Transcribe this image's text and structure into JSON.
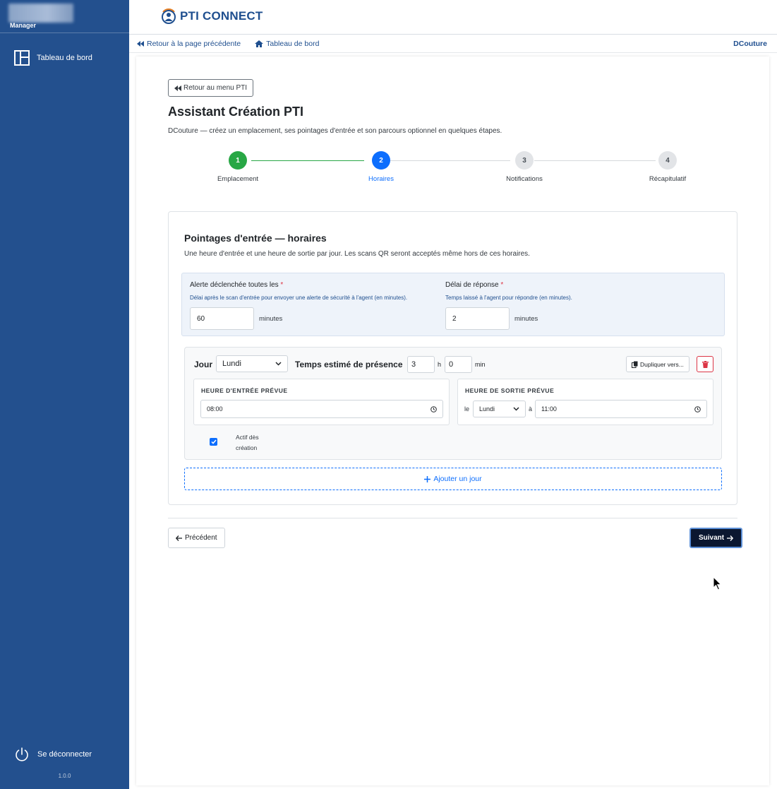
{
  "sidebar": {
    "role": "Manager",
    "nav": [
      {
        "label": "Tableau de bord",
        "icon": "dashboard-layout-icon"
      }
    ],
    "logout_label": "Se déconnecter",
    "version": "1.0.0"
  },
  "header": {
    "brand": "PTI CONNECT",
    "breadcrumbs": {
      "back_label": "Retour à la page précédente",
      "dashboard_label": "Tableau de bord"
    },
    "user": "DCouture"
  },
  "page": {
    "back_menu_label": "Retour au menu PTI",
    "title": "Assistant Création PTI",
    "subtitle": "DCouture — créez un emplacement, ses pointages d'entrée et son parcours optionnel en quelques étapes."
  },
  "stepper": {
    "steps": [
      {
        "number": "1",
        "label": "Emplacement",
        "state": "done"
      },
      {
        "number": "2",
        "label": "Horaires",
        "state": "active"
      },
      {
        "number": "3",
        "label": "Notifications",
        "state": "todo"
      },
      {
        "number": "4",
        "label": "Récapitulatif",
        "state": "todo"
      }
    ],
    "colors": {
      "done": "#28a745",
      "active": "#0d6efd",
      "todo": "#e2e4e7"
    }
  },
  "section": {
    "title": "Pointages d'entrée — horaires",
    "subtitle": "Une heure d'entrée et une heure de sortie par jour. Les scans QR seront acceptés même hors de ces horaires.",
    "alert": {
      "label": "Alerte déclenchée toutes les",
      "required_mark": "*",
      "help": "Délai après le scan d'entrée pour envoyer une alerte de sécurité à l'agent (en minutes).",
      "value": "60",
      "unit": "minutes"
    },
    "response": {
      "label": "Délai de réponse",
      "required_mark": "*",
      "help": "Temps laissé à l'agent pour répondre (en minutes).",
      "value": "2",
      "unit": "minutes"
    },
    "day": {
      "jour_label": "Jour",
      "day_value": "Lundi",
      "estimate_label": "Temps estimé de présence",
      "hours_value": "3",
      "hours_unit": "h",
      "minutes_value": "0",
      "minutes_unit": "min",
      "duplicate_label": "Dupliquer vers...",
      "entry_title": "HEURE D'ENTRÉE PRÉVUE",
      "entry_time": "08:00",
      "exit_title": "HEURE DE SORTIE PRÉVUE",
      "exit_prefix": "le",
      "exit_day": "Lundi",
      "exit_at": "à",
      "exit_time": "11:00",
      "active_label": "Actif dès création",
      "active_checked": true
    },
    "add_day_label": "Ajouter un jour"
  },
  "footer": {
    "prev_label": "Précédent",
    "next_label": "Suivant"
  }
}
